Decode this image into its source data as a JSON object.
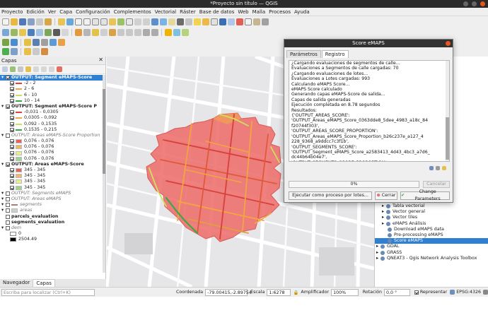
{
  "window": {
    "title": "*Proyecto sin título — QGIS"
  },
  "menu": [
    "Proyecto",
    "Edición",
    "Ver",
    "Capa",
    "Configuración",
    "Complementos",
    "Vectorial",
    "Ráster",
    "Base de datos",
    "Web",
    "Malla",
    "Procesos",
    "Ayuda"
  ],
  "layers_panel": {
    "title": "Capas",
    "items": [
      {
        "label": "OUTPUT: Segment eMAPS-Score",
        "kind": "group",
        "checked": true,
        "selected": true
      },
      {
        "label": "-2 - 2",
        "kind": "line",
        "color": "#e04040"
      },
      {
        "label": "2 - 6",
        "kind": "line",
        "color": "#f2a541"
      },
      {
        "label": "6 - 10",
        "kind": "line",
        "color": "#cfe060"
      },
      {
        "label": "10 - 14",
        "kind": "line",
        "color": "#3aa845"
      },
      {
        "label": "OUTPUT: Segment eMAPS-Score P",
        "kind": "group",
        "checked": true
      },
      {
        "label": "-0,031 - 0,0305",
        "kind": "line",
        "color": "#e04040"
      },
      {
        "label": "0,0305 - 0,092",
        "kind": "line",
        "color": "#f2a541"
      },
      {
        "label": "0,092 - 0,1535",
        "kind": "line",
        "color": "#cfe060"
      },
      {
        "label": "0,1535 - 0,215",
        "kind": "line",
        "color": "#3aa845"
      },
      {
        "label": "OUTPUT: Areas eMAPS-Score Proportion",
        "kind": "group-off",
        "checked": false
      },
      {
        "label": "0,076 - 0,076",
        "kind": "fill",
        "color": "#e8615a"
      },
      {
        "label": "0,076 - 0,076",
        "kind": "fill",
        "color": "#f2b86a"
      },
      {
        "label": "0,076 - 0,076",
        "kind": "fill",
        "color": "#e9ef8c"
      },
      {
        "label": "0,076 - 0,076",
        "kind": "fill",
        "color": "#9bd48a"
      },
      {
        "label": "OUTPUT: Areas eMAPS-Score",
        "kind": "group",
        "checked": true
      },
      {
        "label": "345 - 345",
        "kind": "fill",
        "color": "#e8615a"
      },
      {
        "label": "345 - 345",
        "kind": "fill",
        "color": "#f2b86a"
      },
      {
        "label": "345 - 345",
        "kind": "fill",
        "color": "#e9ef8c"
      },
      {
        "label": "345 - 345",
        "kind": "fill",
        "color": "#9bd48a"
      },
      {
        "label": "OUTPUT: Segments eMAPS",
        "kind": "off-italic",
        "checked": false
      },
      {
        "label": "OUTPUT: Areas eMAPS",
        "kind": "off-italic",
        "checked": false
      },
      {
        "label": "segments",
        "kind": "off-italic-line",
        "checked": false
      },
      {
        "label": "areas",
        "kind": "off-italic-fill",
        "checked": false
      },
      {
        "label": "parcels_evaluation",
        "kind": "off-bold",
        "checked": false
      },
      {
        "label": "segments_evaluation",
        "kind": "off-bold",
        "checked": false
      },
      {
        "label": "dem",
        "kind": "off-italic",
        "checked": false
      },
      {
        "label": "0",
        "kind": "ramp",
        "color": "#ffffff"
      },
      {
        "label": "2504.49",
        "kind": "ramp",
        "color": "#000000"
      }
    ]
  },
  "bottom_tabs": [
    "Navegador",
    "Capas"
  ],
  "dialog": {
    "title": "Score eMAPS",
    "tabs": [
      "Parámetros",
      "Registro"
    ],
    "active_tab": "Registro",
    "log": [
      "¿Cargando evaluaciones de segmentos de calle...",
      "Evaluaciones a Segmentos de calle cargadas: 70",
      "¿Cargando evaluaciones de lotes...",
      "Evaluaciones a Lotes cargadas: 993",
      "Calculando eMAPS Score...",
      "eMAPS Score calculado",
      "Generando capas eMAPS-Score de salida...",
      "Capas de salida generadas",
      "Ejecución completada en 8.78 segundos",
      "Resultados:",
      "{'OUTPUT_AREAS_SCORE':",
      "'OUTPUT_Areas_eMAPS_Score_0363dde8_5dee_4983_a18c_84",
      "f20744f303',",
      "'OUTPUT_AREAS_SCORE_PROPORTION':",
      "'OUTPUT_Areas_eMAPS_Score_Proportion_b26c237e_a127_4",
      "228_9368_a9ddcc7c3f1b',",
      "'OUTPUT_SEGMENTS_SCORE':",
      "'OUTPUT_Segment_eMAPS_Score_a2583413_4d43_4bc3_a7d6_",
      "dc44b64b04e7',",
      "'OUTPUT_SEGMENTS_SCORE_PROPORTION':"
    ],
    "progress_value": 0,
    "progress_text": "0%",
    "cancel_label": "Cancelar",
    "batch_label": "Ejecutar como proceso por lotes...",
    "close_label": "Cerrar",
    "change_params_label": "Change Parameters"
  },
  "processing_tree": [
    {
      "label": "Tabla vectorial",
      "depth": 1
    },
    {
      "label": "Vector general",
      "depth": 1
    },
    {
      "label": "Vector tiles",
      "depth": 1
    },
    {
      "label": "eMAPS Análisis",
      "depth": 1
    },
    {
      "label": "Download eMAPS data",
      "depth": 2
    },
    {
      "label": "Pre-processing eMAPS",
      "depth": 2
    },
    {
      "label": "Score eMAPS",
      "depth": 2,
      "selected": true
    },
    {
      "label": "GDAL",
      "depth": 0
    },
    {
      "label": "GRASS",
      "depth": 0
    },
    {
      "label": "QNEAT3 - Qgis Network Analysis Toolbox",
      "depth": 0
    }
  ],
  "search": {
    "placeholder": "Escriba para localizar (Ctrl+K)"
  },
  "status": {
    "coord_label": "Coordenada",
    "coord_value": "-79.00415,-2.89754",
    "scale_label": "Escala",
    "scale_value": "1:6278",
    "magnifier_label": "Amplificador",
    "magnifier_value": "100%",
    "rotation_label": "Rotación",
    "rotation_value": "0,0 °",
    "render_label": "Representar",
    "crs": "EPSG:4326"
  }
}
